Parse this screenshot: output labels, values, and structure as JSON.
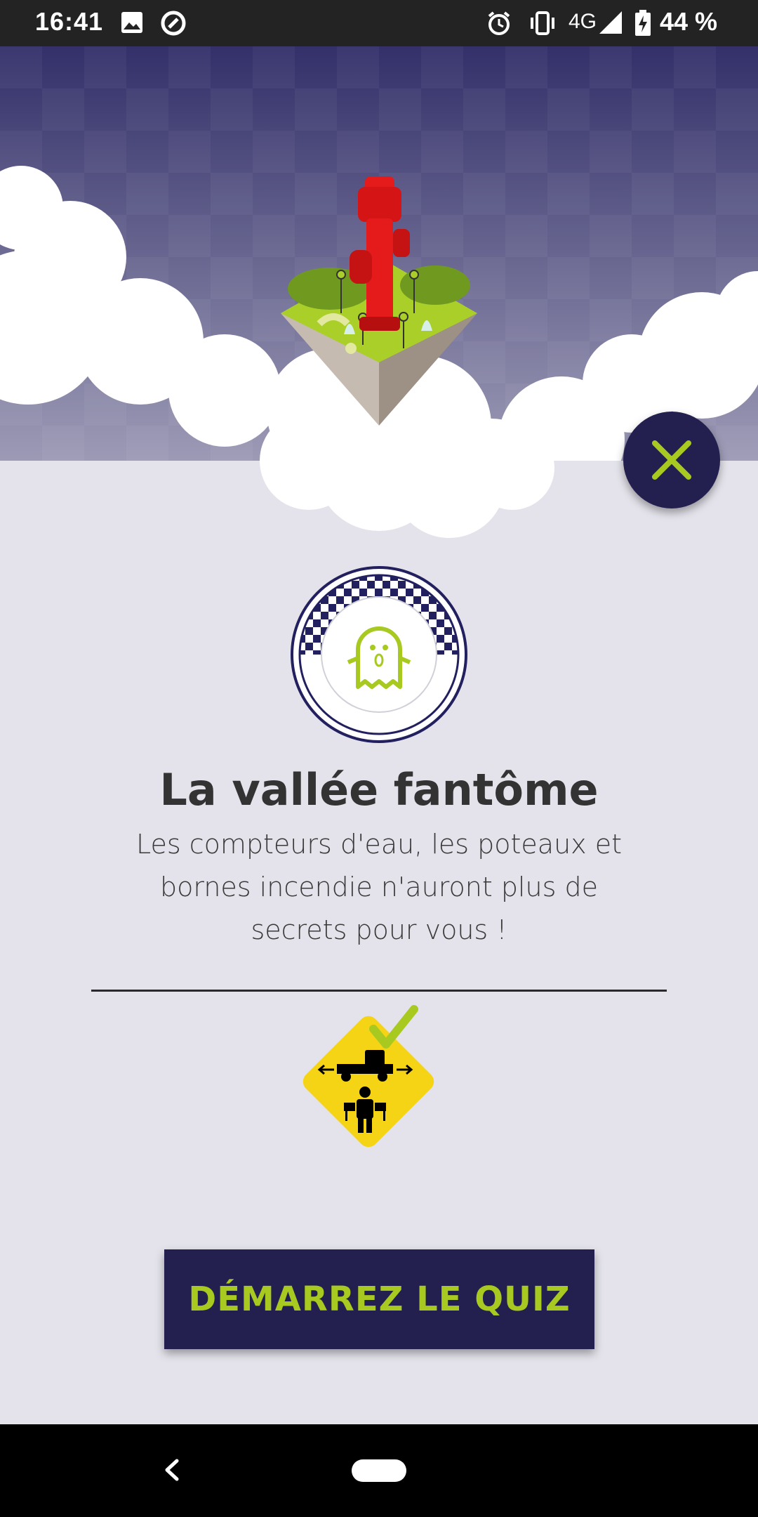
{
  "status_bar": {
    "time": "16:41",
    "network": "4G",
    "battery": "44 %",
    "icons": [
      "image-icon",
      "sync-icon",
      "alarm-icon",
      "vibrate-icon",
      "signal-icon",
      "battery-charging-icon"
    ]
  },
  "hero": {
    "image": "floating-island-fire-hydrant-illustration"
  },
  "close_button": {
    "icon": "close-icon"
  },
  "level": {
    "badge_icon": "ghost-icon",
    "title": "La vallée fantôme",
    "description": "Les compteurs d'eau, les poteaux et bornes incendie n'auront plus de secrets pour vous !",
    "rule_icon": "truck-worker-sign-icon"
  },
  "start_button": {
    "label": "DÉMARREZ LE QUIZ"
  },
  "nav": {
    "back_icon": "back-icon",
    "home_icon": "home-pill-icon"
  },
  "colors": {
    "primary": "#23204f",
    "accent": "#a8c920",
    "background": "#e4e3eb",
    "hydrant": "#e51b1b",
    "sign": "#f5d416"
  }
}
